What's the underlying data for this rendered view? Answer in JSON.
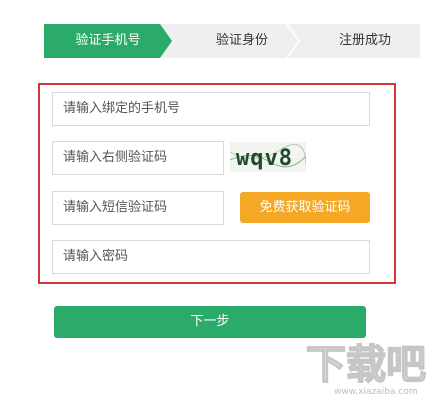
{
  "steps": [
    {
      "label": "验证手机号",
      "active": true
    },
    {
      "label": "验证身份",
      "active": false
    },
    {
      "label": "注册成功",
      "active": false
    }
  ],
  "form": {
    "phone_placeholder": "请输入绑定的手机号",
    "captcha_placeholder": "请输入右侧验证码",
    "captcha_text": "wqv8",
    "sms_placeholder": "请输入短信验证码",
    "sms_button_label": "免费获取验证码",
    "password_placeholder": "请输入密码"
  },
  "actions": {
    "next_label": "下一步"
  },
  "watermark": {
    "text": "下载吧",
    "subtext": "www.xiazaiba.com"
  },
  "colors": {
    "primary_green": "#2bab6a",
    "orange": "#f4a825",
    "highlight_red": "#d3343a"
  }
}
